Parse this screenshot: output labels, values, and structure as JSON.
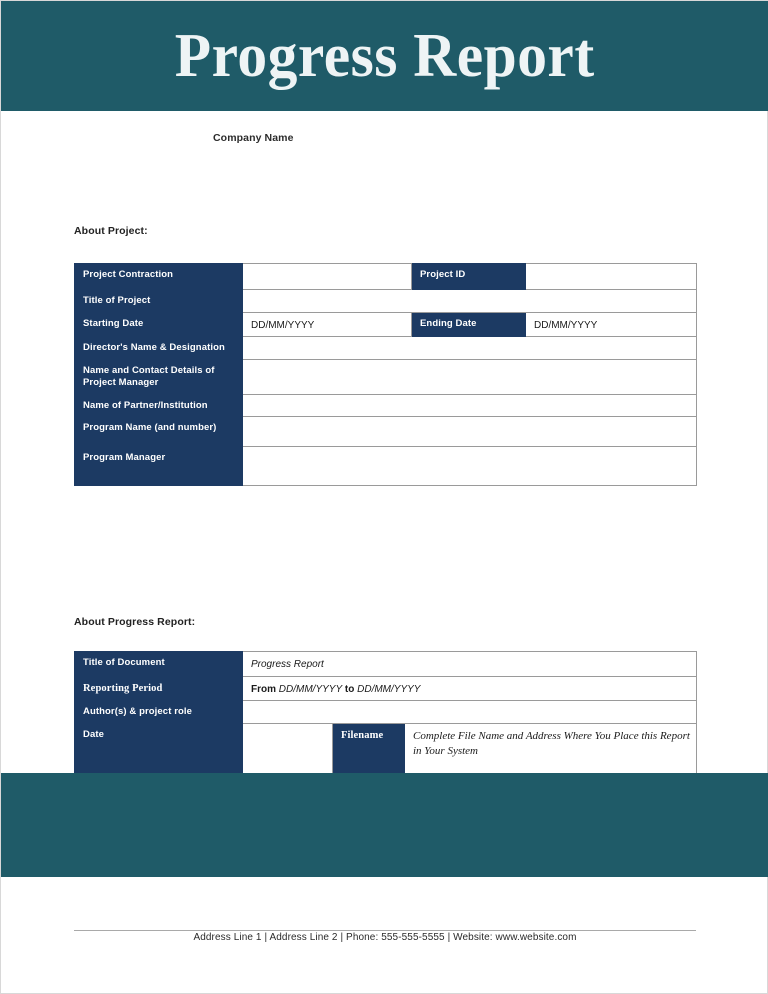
{
  "header": {
    "title": "Progress Report",
    "band_color": "#1f5b68"
  },
  "company_name": "Company Name",
  "accent_colors": {
    "teal": "#1f5b68",
    "navy": "#1c3a63",
    "border": "#9a9a9a"
  },
  "about_project": {
    "heading": "About Project:",
    "rows": [
      {
        "label": "Project Contraction",
        "value": "",
        "label2": "Project ID",
        "value2": ""
      },
      {
        "label": "Title of Project",
        "value": ""
      },
      {
        "label": "Starting Date",
        "value": "DD/MM/YYYY",
        "label2": "Ending Date",
        "value2": "DD/MM/YYYY"
      },
      {
        "label": "Director's Name & Designation",
        "value": ""
      },
      {
        "label": "Name and Contact Details of Project Manager",
        "value": ""
      },
      {
        "label": "Name of Partner/Institution",
        "value": ""
      },
      {
        "label": "Program Name (and number)",
        "value": ""
      },
      {
        "label": "Program Manager",
        "value": ""
      }
    ]
  },
  "about_report": {
    "heading": "About Progress Report:",
    "rows": [
      {
        "label": "Title of Document",
        "value": "Progress Report"
      },
      {
        "label": "Reporting Period",
        "value_prefix": "From ",
        "value_date1": "DD/MM/YYYY",
        "value_mid": " to ",
        "value_date2": "DD/MM/YYYY"
      },
      {
        "label": "Author(s) & project role",
        "value": ""
      },
      {
        "label": "Date",
        "value": "",
        "label2": "Filename",
        "value2": "Complete File Name and Address Where You Place this Report in Your System"
      }
    ]
  },
  "footer": {
    "address": "Address Line 1 | Address Line 2 | Phone: 555-555-5555 | Website: www.website.com"
  }
}
